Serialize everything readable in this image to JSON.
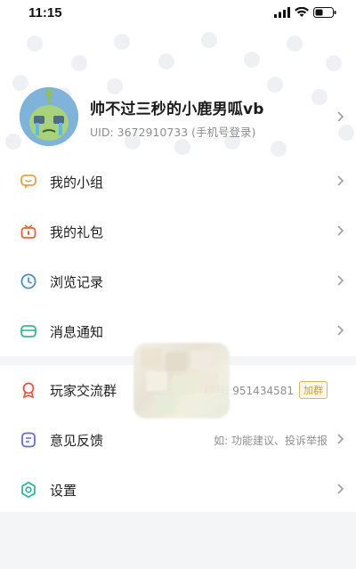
{
  "status_bar": {
    "time": "11:15",
    "icons": [
      "signal-icon",
      "wifi-icon",
      "battery-icon"
    ]
  },
  "profile": {
    "name": "帅不过三秒的小鹿男呱vb",
    "uid": "UID: 3672910733 (手机号登录)"
  },
  "menu": {
    "group1": [
      {
        "label": "我的小组",
        "icon": "chat-bubble-icon",
        "color": "#f0a03c"
      },
      {
        "label": "我的礼包",
        "icon": "gift-icon",
        "color": "#e8623a"
      },
      {
        "label": "浏览记录",
        "icon": "clock-icon",
        "color": "#4a8bd6"
      },
      {
        "label": "消息通知",
        "icon": "envelope-icon",
        "color": "#34b98a"
      }
    ],
    "group2": [
      {
        "label": "玩家交流群",
        "icon": "ribbon-icon",
        "color": "#e7553e",
        "extra": "群号: 951434581",
        "tag": "加群"
      },
      {
        "label": "意见反馈",
        "icon": "feedback-icon",
        "color": "#5b6fd4",
        "extra": "如: 功能建议、投诉举报"
      },
      {
        "label": "设置",
        "icon": "gear-icon",
        "color": "#2eb7a0"
      }
    ]
  }
}
